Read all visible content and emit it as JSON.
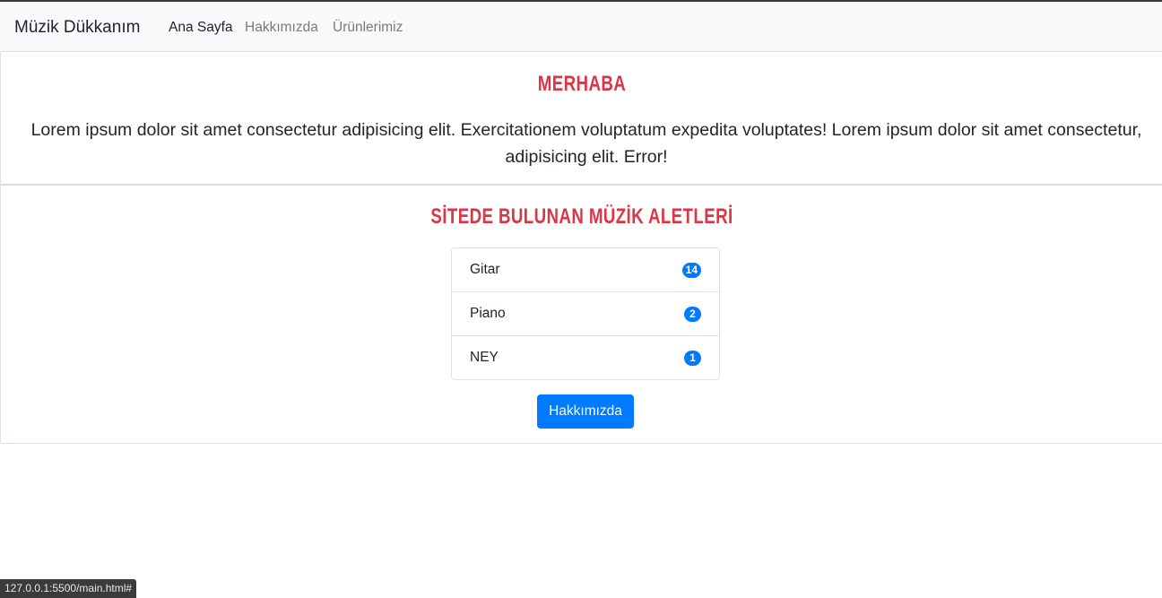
{
  "navbar": {
    "brand": "Müzik Dükkanım",
    "links": [
      {
        "label": "Ana Sayfa",
        "active": true
      },
      {
        "label": "Hakkımızda",
        "active": false
      },
      {
        "label": "Ürünlerimiz",
        "active": false
      }
    ]
  },
  "welcome": {
    "title": "MERHABA",
    "text": "Lorem ipsum dolor sit amet consectetur adipisicing elit. Exercitationem voluptatum expedita voluptates! Lorem ipsum dolor sit amet consectetur, adipisicing elit. Error!"
  },
  "instruments": {
    "title": "SİTEDE BULUNAN MÜZİK ALETLERİ",
    "items": [
      {
        "name": "Gitar",
        "count": "14"
      },
      {
        "name": "Piano",
        "count": "2"
      },
      {
        "name": "NEY",
        "count": "1"
      }
    ],
    "button_label": "Hakkımızda"
  },
  "status_url": "127.0.0.1:5500/main.html#",
  "colors": {
    "heading": "#dc3545",
    "primary": "#007bff",
    "navbar_bg": "#f8f9fa"
  }
}
